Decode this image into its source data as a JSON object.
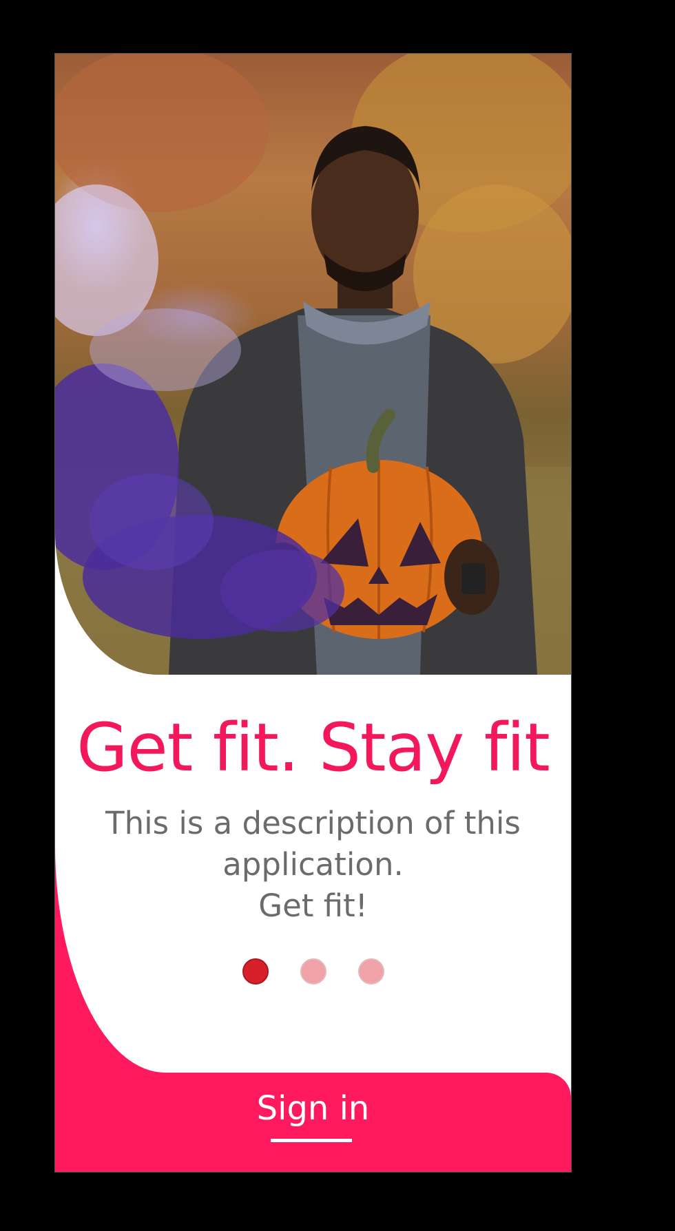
{
  "onboarding": {
    "title": "Get fit. Stay fit",
    "description_lines": [
      "This is a description of this",
      "application.",
      "Get fit!"
    ],
    "signin_label": "Sign in",
    "pager": {
      "count": 3,
      "active_index": 0
    }
  },
  "colors": {
    "accent": "#ff1a5e",
    "title": "#f2185b",
    "description": "#6b6b6b",
    "dot_active": "#d8202a",
    "dot_inactive": "#efa3a8"
  },
  "hero_image": {
    "subject": "photo-man-with-jack-o-lantern-and-purple-smoke"
  }
}
